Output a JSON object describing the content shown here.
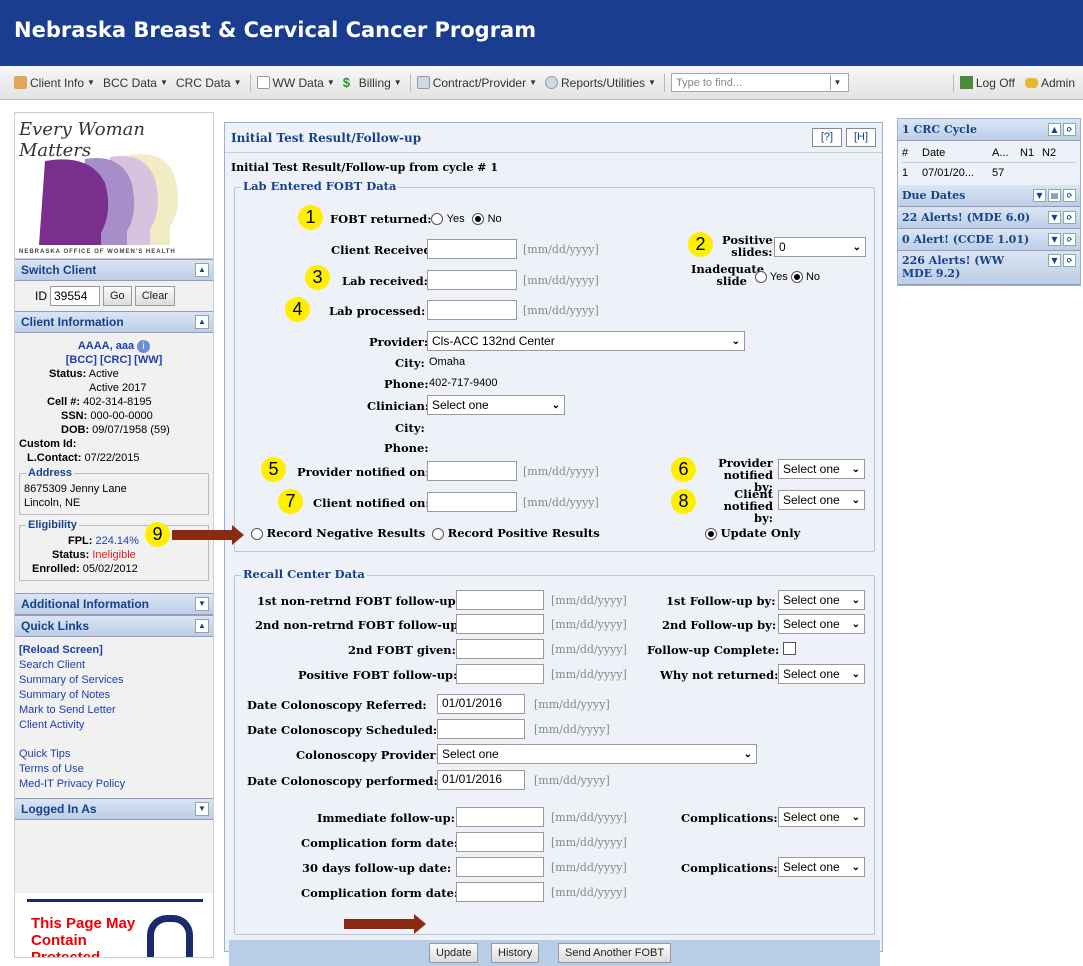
{
  "app": {
    "title": "Nebraska Breast & Cervical Cancer Program"
  },
  "menu": {
    "items": [
      "Client Info",
      "BCC Data",
      "CRC Data",
      "WW Data",
      "Billing",
      "Contract/Provider",
      "Reports/Utilities"
    ],
    "find_placeholder": "Type to find...",
    "logoff": "Log Off",
    "admin": "Admin"
  },
  "sidebar": {
    "logo_text": "Every Woman Matters",
    "logo_sub": "NEBRASKA OFFICE OF WOMEN'S HEALTH",
    "switch_client": {
      "header": "Switch Client",
      "id_label": "ID",
      "id_value": "39554",
      "go": "Go",
      "clear": "Clear"
    },
    "client_info": {
      "header": "Client Information",
      "name": "AAAA, aaa",
      "links": "[BCC] [CRC] [WW]",
      "status_label": "Status:",
      "status": "Active",
      "status2": "Active 2017",
      "cell_label": "Cell #:",
      "cell": "402-314-8195",
      "ssn_label": "SSN:",
      "ssn": "000-00-0000",
      "dob_label": "DOB:",
      "dob": "09/07/1958 (59)",
      "custom_label": "Custom Id:",
      "lcontact_label": "L.Contact:",
      "lcontact": "07/22/2015",
      "address_legend": "Address",
      "address1": "8675309 Jenny Lane",
      "address2": "Lincoln, NE",
      "elig_legend": "Eligibility",
      "fpl_label": "FPL:",
      "fpl": "224.14%",
      "estatus_label": "Status:",
      "estatus": "Ineligible",
      "enrolled_label": "Enrolled:",
      "enrolled": "05/02/2012"
    },
    "additional": "Additional Information",
    "quick_links": {
      "header": "Quick Links",
      "items": [
        "[Reload Screen]",
        "Search Client",
        "Summary of Services",
        "Summary of Notes",
        "Mark to Send Letter",
        "Client Activity"
      ],
      "items2": [
        "Quick Tips",
        "Terms of Use",
        "Med-IT Privacy Policy"
      ]
    },
    "logged_in": "Logged In As",
    "warning": "This Page May Contain Protected"
  },
  "main": {
    "header": "Initial Test Result/Follow-up",
    "help": "[?]",
    "h": "[H]",
    "subtitle": "Initial Test Result/Follow-up from cycle # 1",
    "lab_legend": "Lab Entered FOBT Data",
    "fobt_returned": "FOBT returned:",
    "yes": "Yes",
    "no": "No",
    "client_received": "Client Received:",
    "date_ph": "[mm/dd/yyyy]",
    "positive_slides_1": "Positive",
    "positive_slides_2": "slides:",
    "positive_slides_value": "0",
    "lab_received": "Lab received:",
    "inadequate_1": "Inadequate",
    "inadequate_2": "slide",
    "lab_processed": "Lab processed:",
    "provider_label": "Provider:",
    "provider_value": "Cls-ACC 132nd Center",
    "city_label": "City:",
    "city_value": "Omaha",
    "phone_label": "Phone:",
    "phone_value": "402-717-9400",
    "clinician_label": "Clinician:",
    "select_one": "Select one",
    "provider_notified_on": "Provider notified on:",
    "provider_notified_by_1": "Provider",
    "provider_notified_by_2": "notified by:",
    "client_notified_on": "Client notified on:",
    "client_notified_by_1": "Client",
    "client_notified_by_2": "notified by:",
    "record_negative": "Record Negative Results",
    "record_positive": "Record Positive Results",
    "update_only": "Update Only",
    "recall_legend": "Recall Center Data",
    "nonret1": "1st non-retrnd FOBT follow-up:",
    "nonret2": "2nd non-retrnd FOBT follow-up:",
    "fobt2": "2nd FOBT given:",
    "posfobt": "Positive FOBT follow-up:",
    "fu1": "1st Follow-up by:",
    "fu2": "2nd Follow-up by:",
    "fucomplete": "Follow-up Complete:",
    "whynot": "Why not returned:",
    "col_ref": "Date Colonoscopy Referred:",
    "col_ref_value": "01/01/2016",
    "col_sched": "Date Colonoscopy Scheduled:",
    "col_provider": "Colonoscopy Provider:",
    "col_perf": "Date Colonoscopy performed:",
    "col_perf_value": "01/01/2016",
    "imm_fu": "Immediate follow-up:",
    "complications": "Complications:",
    "comp_form": "Complication form date:",
    "fu30": "30 days follow-up date:",
    "update": "Update",
    "history": "History",
    "send_another": "Send Another FOBT"
  },
  "annotations": [
    "1",
    "2",
    "3",
    "4",
    "5",
    "6",
    "7",
    "8",
    "9"
  ],
  "right": {
    "crc_header": "1 CRC Cycle",
    "cols": [
      "#",
      "Date",
      "A...",
      "N1",
      "N2"
    ],
    "row": [
      "1",
      "07/01/20...",
      "57"
    ],
    "due": "Due Dates",
    "alerts1": "22 Alerts! (MDE 6.0)",
    "alerts2": "0 Alert! (CCDE 1.01)",
    "alerts3": "226 Alerts! (WW MDE 9.2)"
  }
}
